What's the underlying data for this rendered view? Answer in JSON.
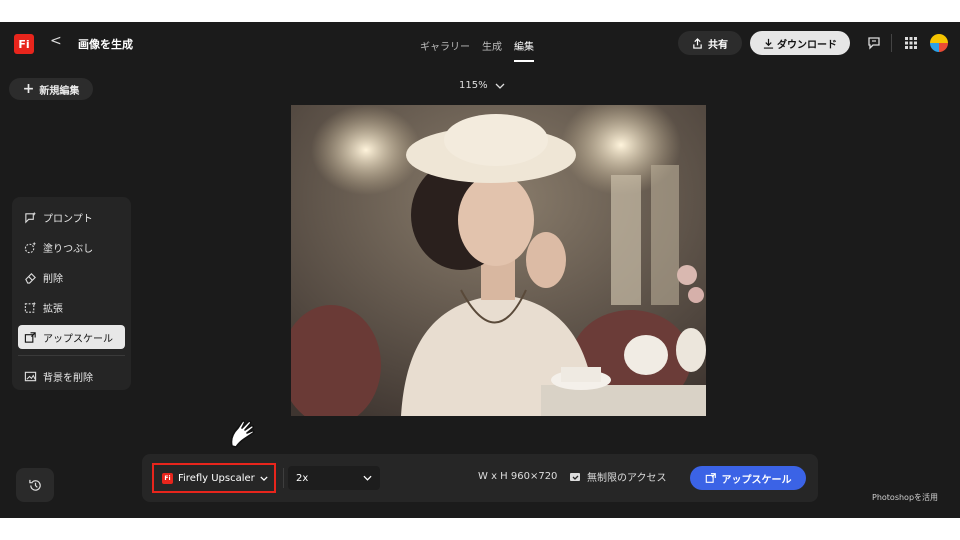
{
  "header": {
    "logo_text": "Fi",
    "back_glyph": "<",
    "title": "画像を生成",
    "tabs": [
      {
        "label": "ギャラリー",
        "active": false
      },
      {
        "label": "生成",
        "active": false
      },
      {
        "label": "編集",
        "active": true
      }
    ],
    "share_label": "共有",
    "download_label": "ダウンロード",
    "icons": [
      "share-icon",
      "download-icon",
      "comment-icon",
      "apps-grid-icon",
      "avatar"
    ]
  },
  "toolbar": {
    "new_edit_label": "新規編集",
    "zoom_label": "115%"
  },
  "tools": {
    "items": [
      {
        "label": "プロンプト",
        "icon": "prompt-icon",
        "active": false
      },
      {
        "label": "塗りつぶし",
        "icon": "fill-icon",
        "active": false
      },
      {
        "label": "削除",
        "icon": "eraser-icon",
        "active": false
      },
      {
        "label": "拡張",
        "icon": "expand-icon",
        "active": false
      },
      {
        "label": "アップスケール",
        "icon": "upscale-icon",
        "active": true
      }
    ],
    "extra": {
      "label": "背景を削除",
      "icon": "remove-background-icon"
    }
  },
  "bottom": {
    "model_label": "Firefly Upscaler",
    "model_logo": "Fi",
    "scale_value": "2x",
    "dimensions": "W x H 960×720",
    "unlimited_label": "無制限のアクセス",
    "upscale_button": "アップスケール"
  },
  "footer": {
    "photoshop_link": "Photoshopを活用"
  },
  "colors": {
    "background": "#1b1b1b",
    "brand_red": "#e8251c",
    "accent_blue": "#3b63e6"
  }
}
